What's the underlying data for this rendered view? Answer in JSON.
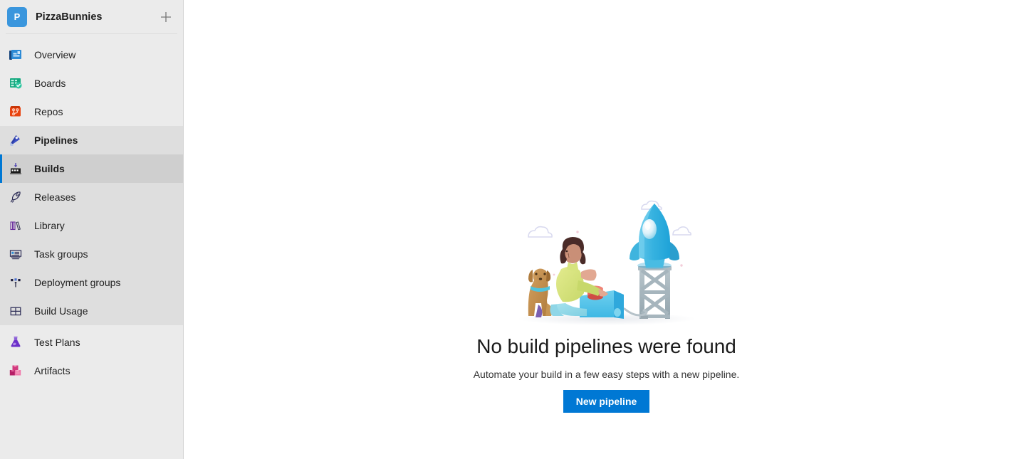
{
  "sidebar": {
    "project": {
      "initial": "P",
      "name": "PizzaBunnies",
      "add_label": "+",
      "avatar_color": "#3a96dd"
    },
    "items": [
      {
        "label": "Overview",
        "icon": "overview-icon",
        "group": "top",
        "selected": false
      },
      {
        "label": "Boards",
        "icon": "boards-icon",
        "group": "top",
        "selected": false
      },
      {
        "label": "Repos",
        "icon": "repos-icon",
        "group": "top",
        "selected": false
      },
      {
        "label": "Pipelines",
        "icon": "pipelines-icon",
        "group": "pipelines",
        "selected": false,
        "bold": true
      },
      {
        "label": "Builds",
        "icon": "builds-icon",
        "group": "pipelines",
        "selected": true,
        "bold": true
      },
      {
        "label": "Releases",
        "icon": "releases-icon",
        "group": "pipelines",
        "selected": false
      },
      {
        "label": "Library",
        "icon": "library-icon",
        "group": "pipelines",
        "selected": false
      },
      {
        "label": "Task groups",
        "icon": "task-groups-icon",
        "group": "pipelines",
        "selected": false
      },
      {
        "label": "Deployment groups",
        "icon": "deployment-groups-icon",
        "group": "pipelines",
        "selected": false
      },
      {
        "label": "Build Usage",
        "icon": "build-usage-icon",
        "group": "pipelines",
        "selected": false
      },
      {
        "label": "Test Plans",
        "icon": "test-plans-icon",
        "group": "bottom",
        "selected": false
      },
      {
        "label": "Artifacts",
        "icon": "artifacts-icon",
        "group": "bottom",
        "selected": false
      }
    ]
  },
  "main": {
    "empty_state": {
      "illustration": "rocket-launch-illustration",
      "title": "No build pipelines were found",
      "subtitle": "Automate your build in a few easy steps with a new pipeline.",
      "button_label": "New pipeline",
      "button_color": "#0078d4"
    }
  }
}
